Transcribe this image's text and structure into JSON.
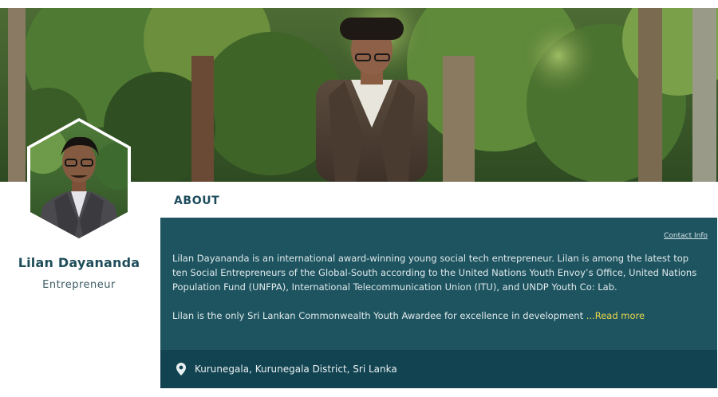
{
  "profile": {
    "name": "Lilan Dayananda",
    "role": "Entrepreneur"
  },
  "about": {
    "heading": "ABOUT",
    "contact_link": "Contact Info",
    "bio_paragraph_1": "Lilan Dayananda is an international award-winning young social tech entrepreneur. Lilan is among the latest top ten Social Entrepreneurs of the Global-South according to the United Nations Youth Envoy’s Office, United Nations Population Fund (UNFPA), International Telecommunication Union (ITU), and UNDP Youth Co: Lab.",
    "bio_paragraph_2": "Lilan is the only Sri Lankan Commonwealth Youth Awardee for excellence in development",
    "read_more": "...Read more"
  },
  "location": {
    "icon": "map-pin-icon",
    "text": "Kurunegala, Kurunegala District, Sri Lanka"
  },
  "colors": {
    "card_bg": "#1e5460",
    "location_bg": "#124351",
    "heading": "#1d4c5c",
    "read_more": "#e9d84a"
  }
}
